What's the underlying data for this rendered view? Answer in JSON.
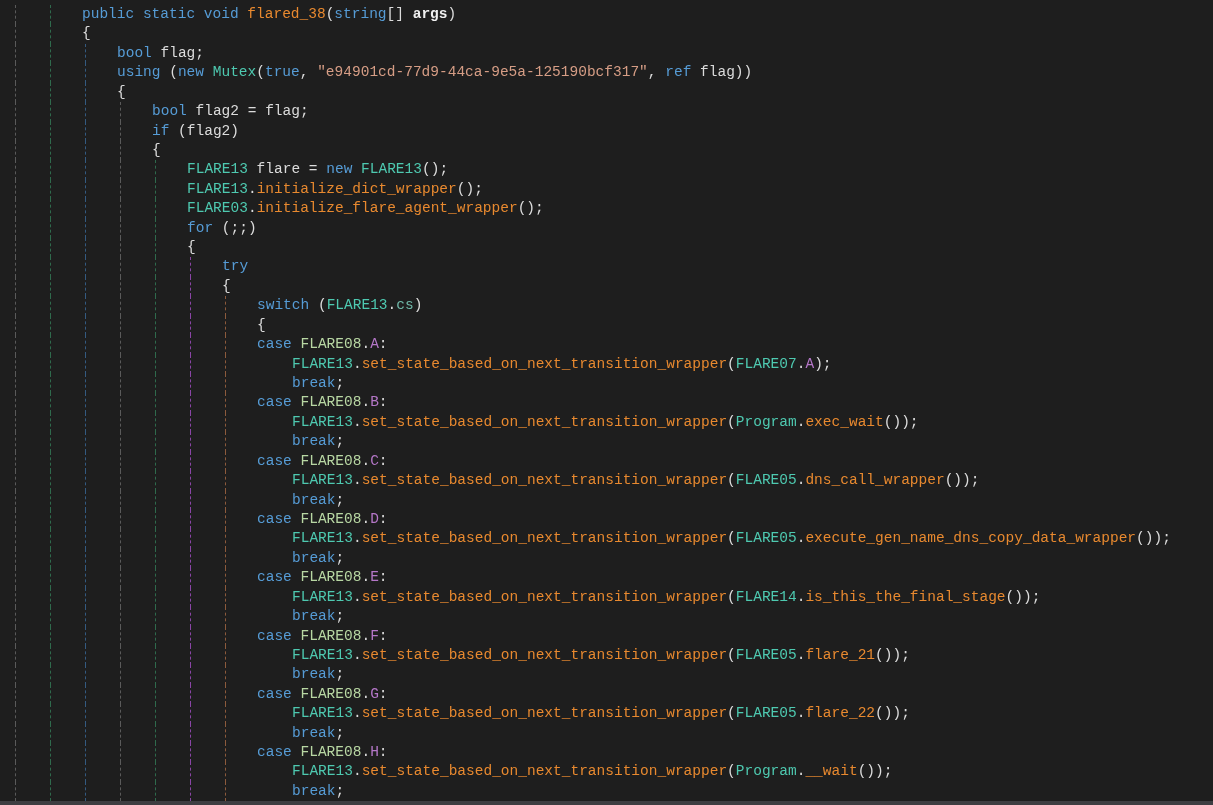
{
  "code": [
    {
      "tokens": [
        {
          "text": "public static void ",
          "kind": "keyword"
        },
        {
          "text": "flared_38",
          "kind": "method"
        },
        {
          "text": "(",
          "kind": "plain"
        },
        {
          "text": "string",
          "kind": "keyword"
        },
        {
          "text": "[] ",
          "kind": "plain"
        },
        {
          "text": "args",
          "kind": "param"
        },
        {
          "text": ")",
          "kind": "plain"
        }
      ]
    },
    {
      "kind": "brace",
      "tokens": [
        {
          "text": "{",
          "kind": "plain"
        }
      ],
      "children": [
        {
          "tokens": [
            {
              "text": "bool ",
              "kind": "keyword"
            },
            {
              "text": "flag;",
              "kind": "plain"
            }
          ]
        },
        {
          "tokens": [
            {
              "text": "using",
              "kind": "keyword"
            },
            {
              "text": " (",
              "kind": "plain"
            },
            {
              "text": "new ",
              "kind": "keyword"
            },
            {
              "text": "Mutex",
              "kind": "type"
            },
            {
              "text": "(",
              "kind": "plain"
            },
            {
              "text": "true",
              "kind": "keyword"
            },
            {
              "text": ", ",
              "kind": "plain"
            },
            {
              "text": "\"e94901cd-77d9-44ca-9e5a-125190bcf317\"",
              "kind": "string"
            },
            {
              "text": ", ",
              "kind": "plain"
            },
            {
              "text": "ref ",
              "kind": "keyword"
            },
            {
              "text": "flag))",
              "kind": "plain"
            }
          ]
        },
        {
          "kind": "brace",
          "tokens": [
            {
              "text": "{",
              "kind": "plain"
            }
          ],
          "children": [
            {
              "tokens": [
                {
                  "text": "bool ",
                  "kind": "keyword"
                },
                {
                  "text": "flag2 = flag;",
                  "kind": "plain"
                }
              ]
            },
            {
              "tokens": [
                {
                  "text": "if",
                  "kind": "keyword"
                },
                {
                  "text": " (flag2)",
                  "kind": "plain"
                }
              ]
            },
            {
              "kind": "brace",
              "tokens": [
                {
                  "text": "{",
                  "kind": "plain"
                }
              ],
              "children": [
                {
                  "tokens": [
                    {
                      "text": "FLARE13",
                      "kind": "type"
                    },
                    {
                      "text": " flare = ",
                      "kind": "plain"
                    },
                    {
                      "text": "new ",
                      "kind": "keyword"
                    },
                    {
                      "text": "FLARE13",
                      "kind": "type"
                    },
                    {
                      "text": "();",
                      "kind": "plain"
                    }
                  ]
                },
                {
                  "tokens": [
                    {
                      "text": "FLARE13",
                      "kind": "type"
                    },
                    {
                      "text": ".",
                      "kind": "plain"
                    },
                    {
                      "text": "initialize_dict_wrapper",
                      "kind": "method"
                    },
                    {
                      "text": "();",
                      "kind": "plain"
                    }
                  ]
                },
                {
                  "tokens": [
                    {
                      "text": "FLARE03",
                      "kind": "type"
                    },
                    {
                      "text": ".",
                      "kind": "plain"
                    },
                    {
                      "text": "initialize_flare_agent_wrapper",
                      "kind": "method"
                    },
                    {
                      "text": "();",
                      "kind": "plain"
                    }
                  ]
                },
                {
                  "tokens": [
                    {
                      "text": "for",
                      "kind": "keyword"
                    },
                    {
                      "text": " (;;)",
                      "kind": "plain"
                    }
                  ]
                },
                {
                  "kind": "brace",
                  "tokens": [
                    {
                      "text": "{",
                      "kind": "plain"
                    }
                  ],
                  "children": [
                    {
                      "tokens": [
                        {
                          "text": "try",
                          "kind": "keyword"
                        }
                      ]
                    },
                    {
                      "kind": "brace",
                      "tokens": [
                        {
                          "text": "{",
                          "kind": "plain"
                        }
                      ],
                      "children": [
                        {
                          "tokens": [
                            {
                              "text": "switch",
                              "kind": "keyword"
                            },
                            {
                              "text": " (",
                              "kind": "plain"
                            },
                            {
                              "text": "FLARE13",
                              "kind": "type"
                            },
                            {
                              "text": ".",
                              "kind": "plain"
                            },
                            {
                              "text": "cs",
                              "kind": "field"
                            },
                            {
                              "text": ")",
                              "kind": "plain"
                            }
                          ]
                        },
                        {
                          "tokens": [
                            {
                              "text": "{",
                              "kind": "plain"
                            }
                          ]
                        },
                        {
                          "kind": "case",
                          "tokens": [
                            {
                              "text": "case ",
                              "kind": "keyword"
                            },
                            {
                              "text": "FLARE08",
                              "kind": "enum"
                            },
                            {
                              "text": ".",
                              "kind": "plain"
                            },
                            {
                              "text": "A",
                              "kind": "member"
                            },
                            {
                              "text": ":",
                              "kind": "plain"
                            }
                          ],
                          "children": [
                            {
                              "tokens": [
                                {
                                  "text": "FLARE13",
                                  "kind": "type"
                                },
                                {
                                  "text": ".",
                                  "kind": "plain"
                                },
                                {
                                  "text": "set_state_based_on_next_transition_wrapper",
                                  "kind": "method"
                                },
                                {
                                  "text": "(",
                                  "kind": "plain"
                                },
                                {
                                  "text": "FLARE07",
                                  "kind": "type"
                                },
                                {
                                  "text": ".",
                                  "kind": "plain"
                                },
                                {
                                  "text": "A",
                                  "kind": "member"
                                },
                                {
                                  "text": ");",
                                  "kind": "plain"
                                }
                              ]
                            },
                            {
                              "tokens": [
                                {
                                  "text": "break",
                                  "kind": "keyword"
                                },
                                {
                                  "text": ";",
                                  "kind": "plain"
                                }
                              ]
                            }
                          ]
                        },
                        {
                          "kind": "case",
                          "tokens": [
                            {
                              "text": "case ",
                              "kind": "keyword"
                            },
                            {
                              "text": "FLARE08",
                              "kind": "enum"
                            },
                            {
                              "text": ".",
                              "kind": "plain"
                            },
                            {
                              "text": "B",
                              "kind": "member"
                            },
                            {
                              "text": ":",
                              "kind": "plain"
                            }
                          ],
                          "children": [
                            {
                              "tokens": [
                                {
                                  "text": "FLARE13",
                                  "kind": "type"
                                },
                                {
                                  "text": ".",
                                  "kind": "plain"
                                },
                                {
                                  "text": "set_state_based_on_next_transition_wrapper",
                                  "kind": "method"
                                },
                                {
                                  "text": "(",
                                  "kind": "plain"
                                },
                                {
                                  "text": "Program",
                                  "kind": "type"
                                },
                                {
                                  "text": ".",
                                  "kind": "plain"
                                },
                                {
                                  "text": "exec_wait",
                                  "kind": "method"
                                },
                                {
                                  "text": "());",
                                  "kind": "plain"
                                }
                              ]
                            },
                            {
                              "tokens": [
                                {
                                  "text": "break",
                                  "kind": "keyword"
                                },
                                {
                                  "text": ";",
                                  "kind": "plain"
                                }
                              ]
                            }
                          ]
                        },
                        {
                          "kind": "case",
                          "tokens": [
                            {
                              "text": "case ",
                              "kind": "keyword"
                            },
                            {
                              "text": "FLARE08",
                              "kind": "enum"
                            },
                            {
                              "text": ".",
                              "kind": "plain"
                            },
                            {
                              "text": "C",
                              "kind": "member"
                            },
                            {
                              "text": ":",
                              "kind": "plain"
                            }
                          ],
                          "children": [
                            {
                              "tokens": [
                                {
                                  "text": "FLARE13",
                                  "kind": "type"
                                },
                                {
                                  "text": ".",
                                  "kind": "plain"
                                },
                                {
                                  "text": "set_state_based_on_next_transition_wrapper",
                                  "kind": "method"
                                },
                                {
                                  "text": "(",
                                  "kind": "plain"
                                },
                                {
                                  "text": "FLARE05",
                                  "kind": "type"
                                },
                                {
                                  "text": ".",
                                  "kind": "plain"
                                },
                                {
                                  "text": "dns_call_wrapper",
                                  "kind": "method"
                                },
                                {
                                  "text": "());",
                                  "kind": "plain"
                                }
                              ]
                            },
                            {
                              "tokens": [
                                {
                                  "text": "break",
                                  "kind": "keyword"
                                },
                                {
                                  "text": ";",
                                  "kind": "plain"
                                }
                              ]
                            }
                          ]
                        },
                        {
                          "kind": "case",
                          "tokens": [
                            {
                              "text": "case ",
                              "kind": "keyword"
                            },
                            {
                              "text": "FLARE08",
                              "kind": "enum"
                            },
                            {
                              "text": ".",
                              "kind": "plain"
                            },
                            {
                              "text": "D",
                              "kind": "member"
                            },
                            {
                              "text": ":",
                              "kind": "plain"
                            }
                          ],
                          "children": [
                            {
                              "tokens": [
                                {
                                  "text": "FLARE13",
                                  "kind": "type"
                                },
                                {
                                  "text": ".",
                                  "kind": "plain"
                                },
                                {
                                  "text": "set_state_based_on_next_transition_wrapper",
                                  "kind": "method"
                                },
                                {
                                  "text": "(",
                                  "kind": "plain"
                                },
                                {
                                  "text": "FLARE05",
                                  "kind": "type"
                                },
                                {
                                  "text": ".",
                                  "kind": "plain"
                                },
                                {
                                  "text": "execute_gen_name_dns_copy_data_wrapper",
                                  "kind": "method"
                                },
                                {
                                  "text": "());",
                                  "kind": "plain"
                                }
                              ]
                            },
                            {
                              "tokens": [
                                {
                                  "text": "break",
                                  "kind": "keyword"
                                },
                                {
                                  "text": ";",
                                  "kind": "plain"
                                }
                              ]
                            }
                          ]
                        },
                        {
                          "kind": "case",
                          "tokens": [
                            {
                              "text": "case ",
                              "kind": "keyword"
                            },
                            {
                              "text": "FLARE08",
                              "kind": "enum"
                            },
                            {
                              "text": ".",
                              "kind": "plain"
                            },
                            {
                              "text": "E",
                              "kind": "member"
                            },
                            {
                              "text": ":",
                              "kind": "plain"
                            }
                          ],
                          "children": [
                            {
                              "tokens": [
                                {
                                  "text": "FLARE13",
                                  "kind": "type"
                                },
                                {
                                  "text": ".",
                                  "kind": "plain"
                                },
                                {
                                  "text": "set_state_based_on_next_transition_wrapper",
                                  "kind": "method"
                                },
                                {
                                  "text": "(",
                                  "kind": "plain"
                                },
                                {
                                  "text": "FLARE14",
                                  "kind": "type"
                                },
                                {
                                  "text": ".",
                                  "kind": "plain"
                                },
                                {
                                  "text": "is_this_the_final_stage",
                                  "kind": "method"
                                },
                                {
                                  "text": "());",
                                  "kind": "plain"
                                }
                              ]
                            },
                            {
                              "tokens": [
                                {
                                  "text": "break",
                                  "kind": "keyword"
                                },
                                {
                                  "text": ";",
                                  "kind": "plain"
                                }
                              ]
                            }
                          ]
                        },
                        {
                          "kind": "case",
                          "tokens": [
                            {
                              "text": "case ",
                              "kind": "keyword"
                            },
                            {
                              "text": "FLARE08",
                              "kind": "enum"
                            },
                            {
                              "text": ".",
                              "kind": "plain"
                            },
                            {
                              "text": "F",
                              "kind": "member"
                            },
                            {
                              "text": ":",
                              "kind": "plain"
                            }
                          ],
                          "children": [
                            {
                              "tokens": [
                                {
                                  "text": "FLARE13",
                                  "kind": "type"
                                },
                                {
                                  "text": ".",
                                  "kind": "plain"
                                },
                                {
                                  "text": "set_state_based_on_next_transition_wrapper",
                                  "kind": "method"
                                },
                                {
                                  "text": "(",
                                  "kind": "plain"
                                },
                                {
                                  "text": "FLARE05",
                                  "kind": "type"
                                },
                                {
                                  "text": ".",
                                  "kind": "plain"
                                },
                                {
                                  "text": "flare_21",
                                  "kind": "method"
                                },
                                {
                                  "text": "());",
                                  "kind": "plain"
                                }
                              ]
                            },
                            {
                              "tokens": [
                                {
                                  "text": "break",
                                  "kind": "keyword"
                                },
                                {
                                  "text": ";",
                                  "kind": "plain"
                                }
                              ]
                            }
                          ]
                        },
                        {
                          "kind": "case",
                          "tokens": [
                            {
                              "text": "case ",
                              "kind": "keyword"
                            },
                            {
                              "text": "FLARE08",
                              "kind": "enum"
                            },
                            {
                              "text": ".",
                              "kind": "plain"
                            },
                            {
                              "text": "G",
                              "kind": "member"
                            },
                            {
                              "text": ":",
                              "kind": "plain"
                            }
                          ],
                          "children": [
                            {
                              "tokens": [
                                {
                                  "text": "FLARE13",
                                  "kind": "type"
                                },
                                {
                                  "text": ".",
                                  "kind": "plain"
                                },
                                {
                                  "text": "set_state_based_on_next_transition_wrapper",
                                  "kind": "method"
                                },
                                {
                                  "text": "(",
                                  "kind": "plain"
                                },
                                {
                                  "text": "FLARE05",
                                  "kind": "type"
                                },
                                {
                                  "text": ".",
                                  "kind": "plain"
                                },
                                {
                                  "text": "flare_22",
                                  "kind": "method"
                                },
                                {
                                  "text": "());",
                                  "kind": "plain"
                                }
                              ]
                            },
                            {
                              "tokens": [
                                {
                                  "text": "break",
                                  "kind": "keyword"
                                },
                                {
                                  "text": ";",
                                  "kind": "plain"
                                }
                              ]
                            }
                          ]
                        },
                        {
                          "kind": "case",
                          "tokens": [
                            {
                              "text": "case ",
                              "kind": "keyword"
                            },
                            {
                              "text": "FLARE08",
                              "kind": "enum"
                            },
                            {
                              "text": ".",
                              "kind": "plain"
                            },
                            {
                              "text": "H",
                              "kind": "member"
                            },
                            {
                              "text": ":",
                              "kind": "plain"
                            }
                          ],
                          "children": [
                            {
                              "tokens": [
                                {
                                  "text": "FLARE13",
                                  "kind": "type"
                                },
                                {
                                  "text": ".",
                                  "kind": "plain"
                                },
                                {
                                  "text": "set_state_based_on_next_transition_wrapper",
                                  "kind": "method"
                                },
                                {
                                  "text": "(",
                                  "kind": "plain"
                                },
                                {
                                  "text": "Program",
                                  "kind": "type"
                                },
                                {
                                  "text": ".",
                                  "kind": "plain"
                                },
                                {
                                  "text": "__wait",
                                  "kind": "method"
                                },
                                {
                                  "text": "());",
                                  "kind": "plain"
                                }
                              ]
                            },
                            {
                              "tokens": [
                                {
                                  "text": "break",
                                  "kind": "keyword"
                                },
                                {
                                  "text": ";",
                                  "kind": "plain"
                                }
                              ]
                            }
                          ]
                        }
                      ]
                    }
                  ]
                }
              ]
            }
          ]
        }
      ]
    }
  ]
}
